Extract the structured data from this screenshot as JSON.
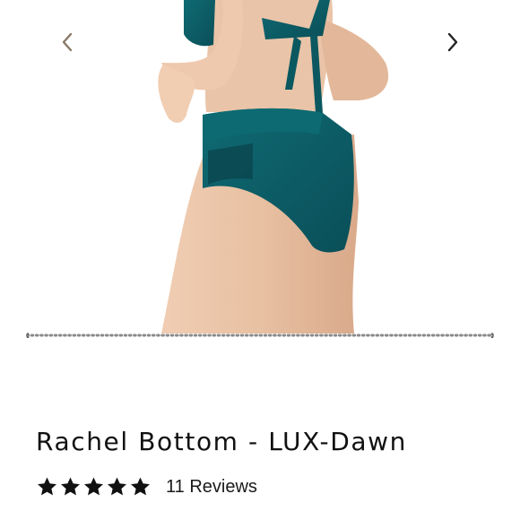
{
  "product": {
    "title": "Rachel Bottom - LUX-Dawn",
    "rating_stars": 5,
    "reviews_label": "11 Reviews"
  },
  "gallery": {
    "prev_icon": "chevron-left-icon",
    "next_icon": "chevron-right-icon",
    "image": "teal high-waist bikini bottom worn by model, back view",
    "colors": {
      "swimsuit": "#0d5d66",
      "skin": "#e7bfa2",
      "arrow_prev": "#8a7a66",
      "arrow_next": "#222222"
    }
  }
}
